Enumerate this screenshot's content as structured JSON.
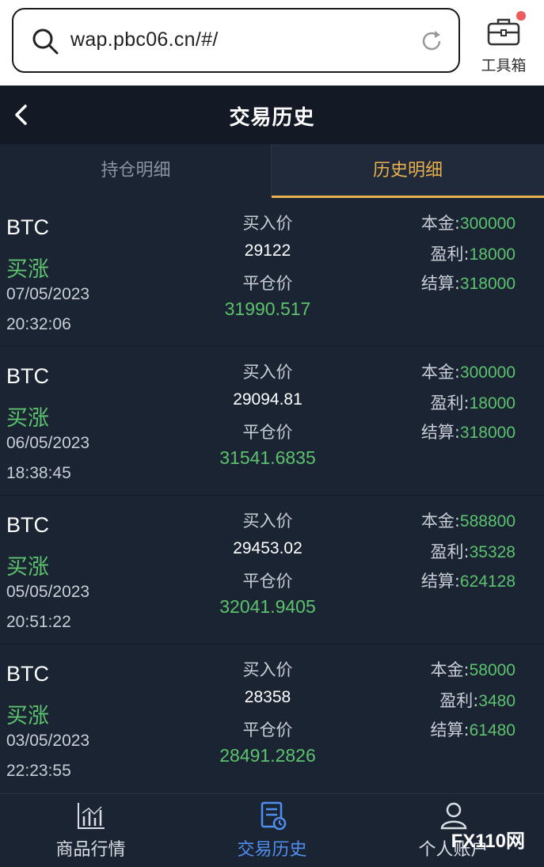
{
  "browser": {
    "url": "wap.pbc06.cn/#/",
    "toolbox_label": "工具箱"
  },
  "header": {
    "title": "交易历史"
  },
  "tabs": [
    {
      "label": "持仓明细",
      "active": false
    },
    {
      "label": "历史明细",
      "active": true
    }
  ],
  "labels": {
    "buy_price": "买入价",
    "close_price": "平仓价",
    "principal": "本金:",
    "profit": "盈利:",
    "settlement": "结算:"
  },
  "trades": [
    {
      "symbol": "BTC",
      "direction": "买涨",
      "date": "07/05/2023",
      "time": "20:32:06",
      "buy_price": "29122",
      "close_price": "31990.517",
      "principal": "300000",
      "profit": "18000",
      "settlement": "318000"
    },
    {
      "symbol": "BTC",
      "direction": "买涨",
      "date": "06/05/2023",
      "time": "18:38:45",
      "buy_price": "29094.81",
      "close_price": "31541.6835",
      "principal": "300000",
      "profit": "18000",
      "settlement": "318000"
    },
    {
      "symbol": "BTC",
      "direction": "买涨",
      "date": "05/05/2023",
      "time": "20:51:22",
      "buy_price": "29453.02",
      "close_price": "32041.9405",
      "principal": "588800",
      "profit": "35328",
      "settlement": "624128"
    },
    {
      "symbol": "BTC",
      "direction": "买涨",
      "date": "03/05/2023",
      "time": "22:23:55",
      "buy_price": "28358",
      "close_price": "28491.2826",
      "principal": "58000",
      "profit": "3480",
      "settlement": "61480"
    }
  ],
  "bottom_nav": [
    {
      "label": "商品行情",
      "icon": "chart-icon",
      "active": false
    },
    {
      "label": "交易历史",
      "icon": "history-doc-icon",
      "active": true
    },
    {
      "label": "个人账户",
      "icon": "user-icon",
      "active": false
    }
  ],
  "watermark": "FX110网",
  "colors": {
    "profit_green": "#5cc26d",
    "active_tab": "#e8b14d",
    "active_nav": "#4f8ff0",
    "background": "#1b2433"
  }
}
